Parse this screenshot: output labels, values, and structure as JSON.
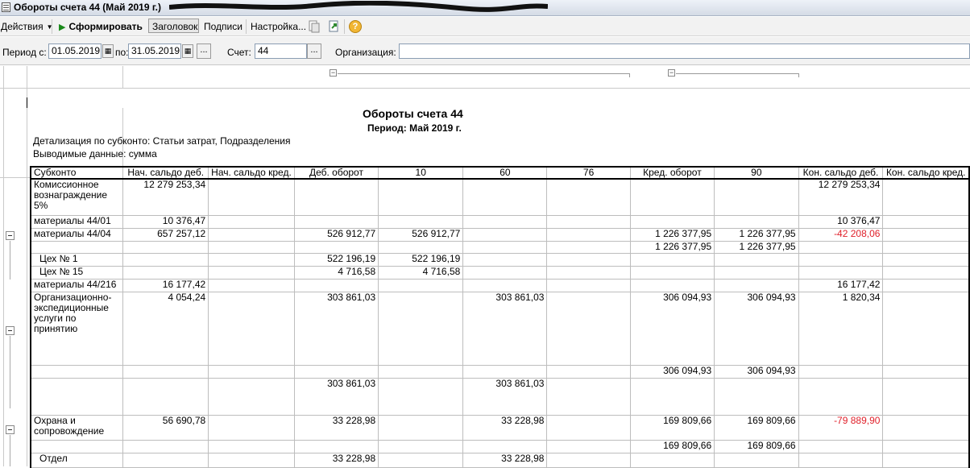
{
  "window": {
    "title": "Обороты счета 44 (Май 2019 г.)"
  },
  "toolbar": {
    "actions_label": "Действия",
    "generate_label": "Сформировать",
    "header_label": "Заголовок",
    "signatures_label": "Подписи",
    "settings_label": "Настройка...",
    "help_label": "?"
  },
  "params": {
    "period_from_label": "Период с:",
    "period_from_value": "01.05.2019",
    "period_to_label": "по:",
    "period_to_value": "31.05.2019",
    "account_label": "Счет:",
    "account_value": "44",
    "org_label": "Организация:",
    "org_value": "",
    "dots": "...",
    "group_toggle": "−"
  },
  "report": {
    "title": "Обороты счета 44",
    "period": "Период: Май 2019 г.",
    "detail": "Детализация по субконто: Статьи затрат, Подразделения",
    "output": "Выводимые данные: сумма",
    "columns": [
      "Субконто",
      "Нач. сальдо деб.",
      "Нач. сальдо кред.",
      "Деб. оборот",
      "10",
      "60",
      "76",
      "Кред. оборот",
      "90",
      "Кон. сальдо деб.",
      "Кон. сальдо кред."
    ],
    "rows": [
      {
        "cells": [
          "Комиссионное вознаграждение 5%",
          "12 279 253,34",
          "",
          "",
          "",
          "",
          "",
          "",
          "",
          "12 279 253,34",
          ""
        ]
      },
      {
        "cells": [
          "материалы 44/01",
          "10 376,47",
          "",
          "",
          "",
          "",
          "",
          "",
          "",
          "10 376,47",
          ""
        ]
      },
      {
        "cells": [
          "материалы 44/04",
          "657 257,12",
          "",
          "526 912,77",
          "526 912,77",
          "",
          "",
          "1 226 377,95",
          "1 226 377,95",
          "-42 208,06",
          ""
        ]
      },
      {
        "cells": [
          "",
          "",
          "",
          "",
          "",
          "",
          "",
          "1 226 377,95",
          "1 226 377,95",
          "",
          ""
        ]
      },
      {
        "cells": [
          "Цех № 1",
          "",
          "",
          "522 196,19",
          "522 196,19",
          "",
          "",
          "",
          "",
          "",
          ""
        ]
      },
      {
        "cells": [
          "Цех № 15",
          "",
          "",
          "4 716,58",
          "4 716,58",
          "",
          "",
          "",
          "",
          "",
          ""
        ]
      },
      {
        "cells": [
          "материалы 44/216",
          "16 177,42",
          "",
          "",
          "",
          "",
          "",
          "",
          "",
          "16 177,42",
          ""
        ]
      },
      {
        "cells": [
          "Организационно-экспедиционные услуги по принятию",
          "4 054,24",
          "",
          "303 861,03",
          "",
          "303 861,03",
          "",
          "306 094,93",
          "306 094,93",
          "1 820,34",
          ""
        ]
      },
      {
        "cells": [
          "",
          "",
          "",
          "",
          "",
          "",
          "",
          "306 094,93",
          "306 094,93",
          "",
          ""
        ]
      },
      {
        "cells": [
          "",
          "",
          "",
          "303 861,03",
          "",
          "303 861,03",
          "",
          "",
          "",
          "",
          ""
        ]
      },
      {
        "cells": [
          "Охрана и сопровождение",
          "56 690,78",
          "",
          "33 228,98",
          "",
          "33 228,98",
          "",
          "169 809,66",
          "169 809,66",
          "-79 889,90",
          ""
        ]
      },
      {
        "cells": [
          "",
          "",
          "",
          "",
          "",
          "",
          "",
          "169 809,66",
          "169 809,66",
          "",
          ""
        ]
      },
      {
        "cells": [
          "Отдел",
          "",
          "",
          "33 228,98",
          "",
          "33 228,98",
          "",
          "",
          "",
          "",
          ""
        ]
      }
    ]
  },
  "colors": {
    "negative": "#e0202a",
    "accent_green": "#1a8a1a"
  }
}
